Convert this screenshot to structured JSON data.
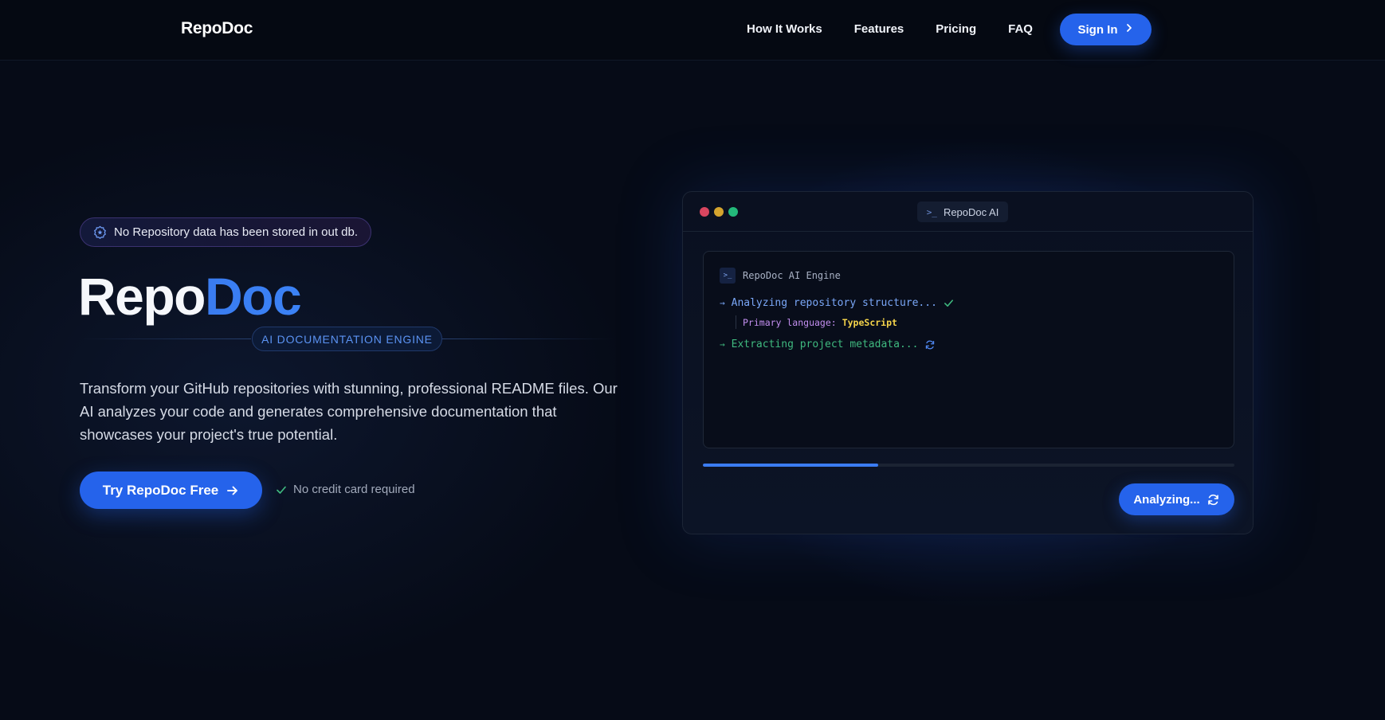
{
  "nav": {
    "brand": "RepoDoc",
    "links": [
      "How It Works",
      "Features",
      "Pricing",
      "FAQ"
    ],
    "signin_label": "Sign In",
    "signin_icon": "chevron-right-icon"
  },
  "hero": {
    "notice": "No Repository data has been stored in out db.",
    "notice_icon": "badge-icon",
    "title_part1": "Repo",
    "title_part2": "Doc",
    "engine_badge": "AI DOCUMENTATION ENGINE",
    "description": "Transform your GitHub repositories with stunning, professional README files. Our AI analyzes your code and generates comprehensive documentation that showcases your project's true potential.",
    "cta_label": "Try RepoDoc Free",
    "cta_icon": "arrow-right-icon",
    "no_cc": "No credit card required"
  },
  "panel": {
    "tab_label": "RepoDoc AI",
    "tab_icon_text": ">_",
    "terminal": {
      "icon_text": ">_",
      "title": "RepoDoc AI Engine",
      "arrow": "→",
      "step1": "Analyzing repository structure...",
      "step1_status": "check-icon",
      "primary_language_key": "Primary language:",
      "primary_language_value": "TypeScript",
      "step2": "Extracting project metadata...",
      "step2_status": "refresh-icon"
    },
    "progress_fraction": 0.33,
    "analyze_label": "Analyzing...",
    "analyze_icon": "refresh-icon"
  },
  "colors": {
    "background": "#060b17",
    "accent": "#2563eb",
    "title_blue": "#3b82f6",
    "terminal_blue": "#7aa7f7",
    "terminal_green": "#3fb97f",
    "terminal_purple": "#c38ff0",
    "terminal_yellow": "#f4d34a",
    "traffic_red": "#d8455f",
    "traffic_yellow": "#d4a42e",
    "traffic_green": "#23b97a"
  }
}
